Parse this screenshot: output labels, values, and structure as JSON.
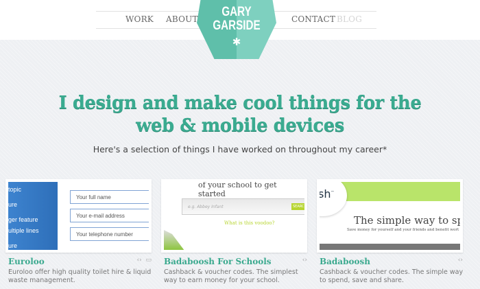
{
  "nav": {
    "work": "WORK",
    "about": "ABOUT",
    "contact": "CONTACT",
    "blog": "BLOG"
  },
  "logo": {
    "line1": "GARY",
    "line2": "GARSIDE",
    "star": "✱"
  },
  "hero": {
    "headline": "I design and make cool things for the web & mobile devices",
    "subtitle": "Here's a selection of things I have worked on throughout my career*"
  },
  "projects": [
    {
      "title": "Euroloo",
      "description": "Euroloo offer high quality toilet hire & liquid waste management.",
      "icons": [
        "code-icon",
        "monitor-icon"
      ],
      "thumb": {
        "menu": [
          "topic",
          "ure",
          "ger feature",
          "ultiple lines",
          "ure"
        ],
        "fields": [
          "Your full name",
          "Your e-mail address",
          "Your telephone number"
        ]
      }
    },
    {
      "title": "Badaboosh For Schools",
      "description": "Cashback & voucher codes. The simplest way to earn money for your school.",
      "icons": [
        "code-icon"
      ],
      "thumb": {
        "heading": "of your school to get started",
        "placeholder": "e.g. Abbey Infant",
        "button": "SEARCH",
        "link": "What is this voodoo?"
      }
    },
    {
      "title": "Badaboosh",
      "description": "Cashback & voucher codes. The simple way to spend, save and share.",
      "icons": [
        "code-icon"
      ],
      "thumb": {
        "logo": "sh",
        "tm": "™",
        "heading": "The simple way to sp",
        "tagline": "Save money for yourself and your friends and benefit wort"
      }
    }
  ],
  "colors": {
    "accent": "#3aab90",
    "logo": "#6cc9b5",
    "lime": "#b9e46a"
  }
}
